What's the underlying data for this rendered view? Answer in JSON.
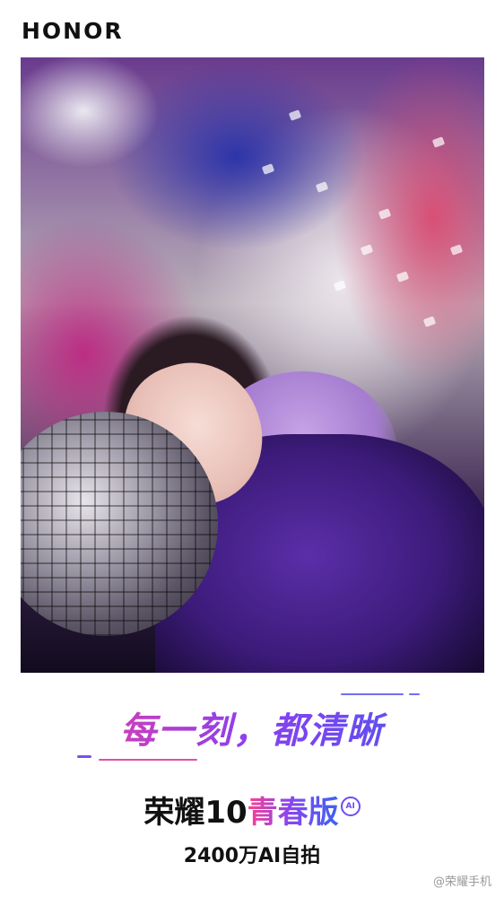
{
  "brand": {
    "logo_text": "HONOR"
  },
  "hero": {
    "image_alt": ""
  },
  "slogan": {
    "text": "每一刻，都清晰"
  },
  "product": {
    "name_part1": "荣耀10",
    "name_part2": "青春版",
    "badge": "AI",
    "subtitle": "2400万AI自拍"
  },
  "watermark": {
    "text": "@荣耀手机"
  },
  "colors": {
    "accent_pink": "#ff3f8e",
    "accent_purple": "#8b3ff0",
    "accent_blue": "#3f5cf0",
    "text_dark": "#111111"
  }
}
